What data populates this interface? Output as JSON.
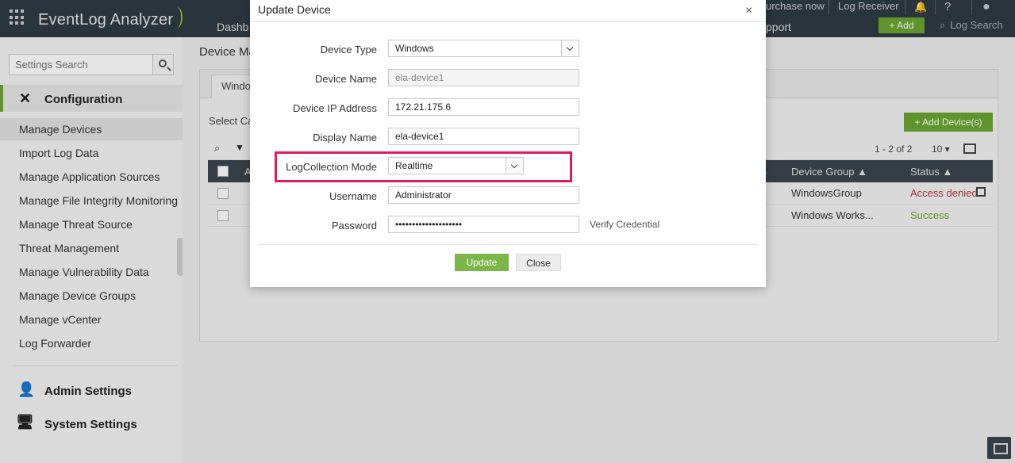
{
  "topbar": {
    "app_title": "EventLog Analyzer",
    "purchase_now": "urchase now",
    "log_receiver": "Log Receiver",
    "help": "?",
    "nav_dashboard": "Dashb",
    "nav_support": "pport",
    "add_label": "+ Add",
    "log_search": "Log Search"
  },
  "sidebar": {
    "search_placeholder": "Settings Search",
    "configuration_label": "Configuration",
    "items": [
      {
        "label": "Manage Devices"
      },
      {
        "label": "Import Log Data"
      },
      {
        "label": "Manage Application Sources"
      },
      {
        "label": "Manage File Integrity Monitoring"
      },
      {
        "label": "Manage Threat Source"
      },
      {
        "label": "Threat Management"
      },
      {
        "label": "Manage Vulnerability Data"
      },
      {
        "label": "Manage Device Groups"
      },
      {
        "label": "Manage vCenter"
      },
      {
        "label": "Log Forwarder"
      }
    ],
    "admin_settings_label": "Admin Settings",
    "system_settings_label": "System Settings"
  },
  "main": {
    "page_title": "Device Ma",
    "tab_label": "Windo",
    "select_category": "Select Ca",
    "add_device_label": "+ Add Device(s)",
    "pager": "1 - 2 of 2",
    "page_size": "10 ▾",
    "col_header_group": "Device Group ▲",
    "col_header_status": "Status ▲",
    "col_header_first": "A",
    "rows": [
      {
        "group": "WindowsGroup",
        "status": "Access denied"
      },
      {
        "group": "Windows Works...",
        "status": "Success"
      }
    ]
  },
  "modal": {
    "title": "Update Device",
    "close": "×",
    "device_type_label": "Device Type",
    "device_type_value": "Windows",
    "device_name_label": "Device Name",
    "device_name_value": "ela-device1",
    "device_ip_label": "Device IP Address",
    "device_ip_value": "172.21.175.6",
    "display_name_label": "Display Name",
    "display_name_value": "ela-device1",
    "log_mode_label": "LogCollection Mode",
    "log_mode_value": "Realtime",
    "username_label": "Username",
    "username_value": "Administrator",
    "password_label": "Password",
    "password_value": "••••••••••••••••••••",
    "verify_credential": "Verify Credential",
    "update_label": "Update",
    "close_label": "Close"
  },
  "colors": {
    "accent_green": "#6aa533",
    "highlight_pink": "#e0195e",
    "topbar_bg": "#2f3a44",
    "error_red": "#b33c3c"
  }
}
